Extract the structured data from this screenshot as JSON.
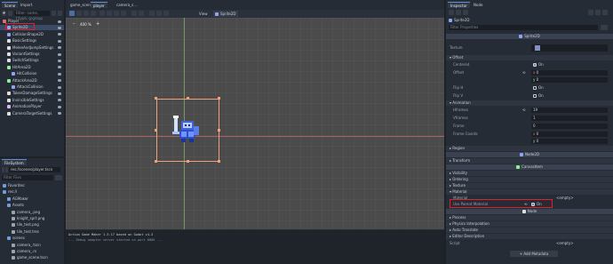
{
  "scene_panel": {
    "tabs": [
      "Scene",
      "Import"
    ],
    "filter_placeholder": "Filter: name, t:type, g:group",
    "tree": [
      {
        "label": "Player",
        "indent": 0,
        "color": "#e06f6f",
        "highlight": false
      },
      {
        "label": "Sprite2D",
        "indent": 1,
        "color": "#8da5f3",
        "highlight": true
      },
      {
        "label": "CollisionShape2D",
        "indent": 1,
        "color": "#8da5f3",
        "highlight": false
      },
      {
        "label": "BasicSettings",
        "indent": 1,
        "color": "#e0e0e0",
        "highlight": false
      },
      {
        "label": "MeleeAndJumpSettings",
        "indent": 1,
        "color": "#e0e0e0",
        "highlight": false
      },
      {
        "label": "VariantSettings",
        "indent": 1,
        "color": "#e0e0e0",
        "highlight": false
      },
      {
        "label": "SwitchSettings",
        "indent": 1,
        "color": "#e0e0e0",
        "highlight": false
      },
      {
        "label": "HitArea2D",
        "indent": 1,
        "color": "#8eef97",
        "highlight": false
      },
      {
        "label": "HitCollision",
        "indent": 2,
        "color": "#8da5f3",
        "highlight": false
      },
      {
        "label": "AttackArea2D",
        "indent": 1,
        "color": "#8eef97",
        "highlight": false
      },
      {
        "label": "AttackCollision",
        "indent": 2,
        "color": "#8da5f3",
        "highlight": false
      },
      {
        "label": "TakenDamageSettings",
        "indent": 1,
        "color": "#e0e0e0",
        "highlight": false
      },
      {
        "label": "InvincibleSettings",
        "indent": 1,
        "color": "#e0e0e0",
        "highlight": false
      },
      {
        "label": "AnimationPlayer",
        "indent": 1,
        "color": "#d7b8f3",
        "highlight": false
      },
      {
        "label": "CameraTargetSettings",
        "indent": 1,
        "color": "#e0e0e0",
        "highlight": false
      }
    ]
  },
  "filesystem": {
    "title": "FileSystem",
    "path": "res://scenes/player.tscn",
    "filter_placeholder": "Filter Files",
    "items": [
      {
        "label": "Favorites:",
        "indent": 0
      },
      {
        "label": "res://",
        "indent": 0
      },
      {
        "label": "AGMaker",
        "indent": 1
      },
      {
        "label": "Assets",
        "indent": 1
      },
      {
        "label": "camera_.png",
        "indent": 2
      },
      {
        "label": "knight_sprt.png",
        "indent": 2
      },
      {
        "label": "tile_test.png",
        "indent": 2
      },
      {
        "label": "tile_test.tres",
        "indent": 2
      },
      {
        "label": "scenes",
        "indent": 1
      },
      {
        "label": "camera_.tscn",
        "indent": 2
      },
      {
        "label": "camera_.rs",
        "indent": 2
      },
      {
        "label": "game_scene.tscn",
        "indent": 2
      }
    ]
  },
  "editor": {
    "tabs": [
      "game_scene",
      "player",
      "camera_s..."
    ],
    "active_tab": 1,
    "view_label": "View",
    "selected_node": "Sprite2D",
    "zoom": "400 %",
    "log_lines": [
      "Action Game Maker 1.3.17 based on Godot v4.3",
      "--- Debug adapter server started on port 6006 ---"
    ]
  },
  "inspector": {
    "tabs": [
      "Inspector",
      "Node"
    ],
    "node_name": "Sprite2D",
    "filter_placeholder": "Filter Properties",
    "class_header": "Sprite2D",
    "texture_label": "Texture",
    "sections": {
      "offset": "Offset",
      "animation": "Animation",
      "region": "Region",
      "transform": "Transform",
      "node2d": "Node2D",
      "canvasitem": "CanvasItem",
      "visibility": "Visibility",
      "ordering": "Ordering",
      "texture": "Texture",
      "material": "Material",
      "node": "Node",
      "process": "Process",
      "physics_interp": "Physics Interpolation",
      "auto_translate": "Auto Translate",
      "editor_desc": "Editor Description"
    },
    "props": {
      "centered": "Centered",
      "centered_val": "On",
      "offset": "Offset",
      "offset_x": "0",
      "offset_y": "0",
      "flip_h": "Flip H",
      "flip_h_val": "On",
      "flip_v": "Flip V",
      "flip_v_val": "On",
      "hframes": "Hframes",
      "hframes_val": "19",
      "vframes": "Vframes",
      "vframes_val": "1",
      "frame": "Frame",
      "frame_val": "0",
      "frame_coords": "Frame Coords",
      "fc_x": "0",
      "fc_y": "0",
      "material": "Material",
      "material_val": "<empty>",
      "use_parent_material": "Use Parent Material",
      "upm_val": "On",
      "script": "Script",
      "script_val": "<empty>",
      "add_metadata": "Add Metadata"
    }
  },
  "colors": {
    "accent": "#5b8fd8",
    "highlight_box": "#e0202a",
    "selection": "#f0a07a"
  }
}
